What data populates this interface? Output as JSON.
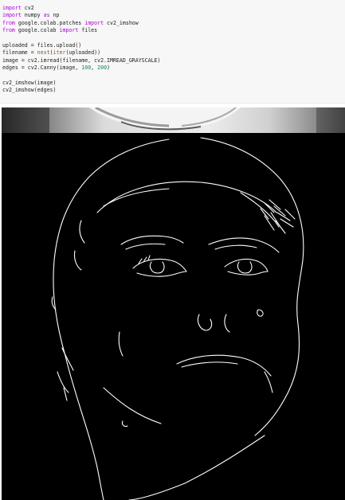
{
  "code_cell": {
    "lines": [
      [
        {
          "t": "import",
          "c": "kw"
        },
        {
          "t": " cv2",
          "c": ""
        }
      ],
      [
        {
          "t": "import",
          "c": "kw"
        },
        {
          "t": " numpy ",
          "c": ""
        },
        {
          "t": "as",
          "c": "kw"
        },
        {
          "t": " np",
          "c": ""
        }
      ],
      [
        {
          "t": "from",
          "c": "kw"
        },
        {
          "t": " google.colab.patches ",
          "c": ""
        },
        {
          "t": "import",
          "c": "kw"
        },
        {
          "t": " cv2_imshow",
          "c": ""
        }
      ],
      [
        {
          "t": "from",
          "c": "kw"
        },
        {
          "t": " google.colab ",
          "c": ""
        },
        {
          "t": "import",
          "c": "kw"
        },
        {
          "t": " files",
          "c": ""
        }
      ],
      [],
      [
        {
          "t": "uploaded = files.upload()",
          "c": ""
        }
      ],
      [
        {
          "t": "filename = ",
          "c": ""
        },
        {
          "t": "next",
          "c": "fn"
        },
        {
          "t": "(",
          "c": ""
        },
        {
          "t": "iter",
          "c": "fn"
        },
        {
          "t": "(uploaded))",
          "c": ""
        }
      ],
      [
        {
          "t": "image = cv2.imread(filename, cv2.IMREAD_GRAYSCALE)",
          "c": ""
        }
      ],
      [
        {
          "t": "edges = cv2.Canny(image, ",
          "c": ""
        },
        {
          "t": "100",
          "c": "num"
        },
        {
          "t": ", ",
          "c": ""
        },
        {
          "t": "200",
          "c": "num"
        },
        {
          "t": ")",
          "c": ""
        }
      ],
      [],
      [
        {
          "t": "cv2_imshow(image)",
          "c": ""
        }
      ],
      [
        {
          "t": "cv2_imshow(edges)",
          "c": ""
        }
      ]
    ]
  },
  "outputs": {
    "image_output_label": "cv2_imshow(image) output",
    "edges_output_label": "cv2_imshow(edges) output"
  }
}
